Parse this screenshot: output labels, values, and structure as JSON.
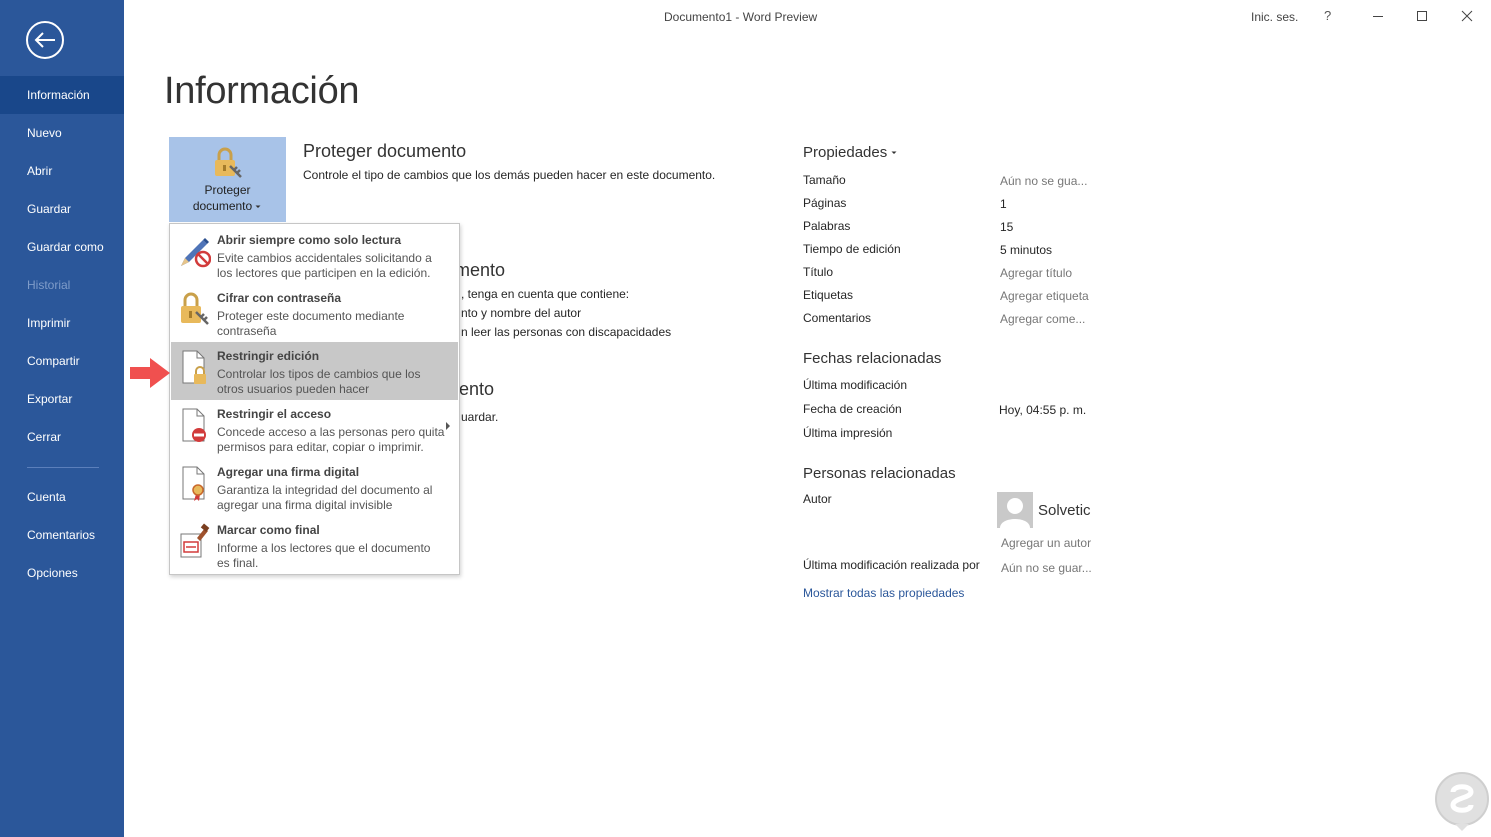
{
  "window": {
    "title": "Documento1  -  Word Preview",
    "signin": "Inic. ses.",
    "help": "?"
  },
  "sidebar": {
    "items": [
      {
        "label": "Información"
      },
      {
        "label": "Nuevo"
      },
      {
        "label": "Abrir"
      },
      {
        "label": "Guardar"
      },
      {
        "label": "Guardar como"
      },
      {
        "label": "Historial"
      },
      {
        "label": "Imprimir"
      },
      {
        "label": "Compartir"
      },
      {
        "label": "Exportar"
      },
      {
        "label": "Cerrar"
      },
      {
        "label": "Cuenta"
      },
      {
        "label": "Comentarios"
      },
      {
        "label": "Opciones"
      }
    ],
    "active": "Información",
    "disabled": "Historial"
  },
  "main": {
    "title": "Información",
    "protect_button": {
      "line1": "Proteger",
      "line2": "documento"
    },
    "protect": {
      "heading": "Proteger documento",
      "description": "Controle el tipo de cambios que los demás pueden hacer en este documento."
    },
    "inspect": {
      "heading_fragment": "mento",
      "line1_fragment": ", tenga en cuenta que contiene:",
      "line2_fragment": "nto y nombre del autor",
      "line3_fragment": "n leer las personas con discapacidades"
    },
    "versions": {
      "heading_fragment": "ento",
      "line1_fragment": "uardar."
    }
  },
  "protect_menu": {
    "items": [
      {
        "title": "Abrir siempre como solo lectura",
        "desc1": "Evite cambios accidentales solicitando a",
        "desc2": "los lectores que participen en la edición.",
        "icon": "pencil-no-icon"
      },
      {
        "title": "Cifrar con contraseña",
        "desc1": "Proteger este documento mediante",
        "desc2": "contraseña",
        "icon": "lock-key-icon"
      },
      {
        "title": "Restringir edición",
        "desc1": "Controlar los tipos de cambios que los",
        "desc2": "otros usuarios pueden hacer",
        "icon": "page-lock-icon"
      },
      {
        "title": "Restringir el acceso",
        "desc1": "Concede acceso a las personas pero quita",
        "desc2": "permisos para editar, copiar o imprimir.",
        "icon": "page-block-icon"
      },
      {
        "title": "Agregar una firma digital",
        "desc1": "Garantiza la integridad del documento al",
        "desc2": "agregar una firma digital invisible",
        "icon": "page-ribbon-icon"
      },
      {
        "title": "Marcar como final",
        "desc1": "Informe a los lectores que el documento",
        "desc2": "es final.",
        "icon": "stamp-icon"
      }
    ],
    "highlighted": "Restringir edición"
  },
  "properties": {
    "heading": "Propiedades",
    "rows": [
      {
        "label": "Tamaño",
        "value": "Aún no se gua..."
      },
      {
        "label": "Páginas",
        "value": "1"
      },
      {
        "label": "Palabras",
        "value": "15"
      },
      {
        "label": "Tiempo de edición",
        "value": "5 minutos"
      },
      {
        "label": "Título",
        "value": "Agregar título"
      },
      {
        "label": "Etiquetas",
        "value": "Agregar etiqueta"
      },
      {
        "label": "Comentarios",
        "value": "Agregar come..."
      }
    ]
  },
  "dates": {
    "heading": "Fechas relacionadas",
    "rows": [
      {
        "label": "Última modificación",
        "value": ""
      },
      {
        "label": "Fecha de creación",
        "value": "Hoy, 04:55 p. m."
      },
      {
        "label": "Última impresión",
        "value": ""
      }
    ]
  },
  "people": {
    "heading": "Personas relacionadas",
    "author_label": "Autor",
    "author_name": "Solvetic",
    "add_author": "Agregar un autor",
    "last_modified_label": "Última modificación realizada por",
    "last_modified_value": "Aún no se guar..."
  },
  "show_all": "Mostrar todas las propiedades",
  "colors": {
    "sidebar": "#2b579a",
    "sidebar_active": "#19478a",
    "protect_button": "#a8c3e8",
    "menu_hover": "#c8c8c8",
    "accent_arrow": "#f0504f"
  }
}
